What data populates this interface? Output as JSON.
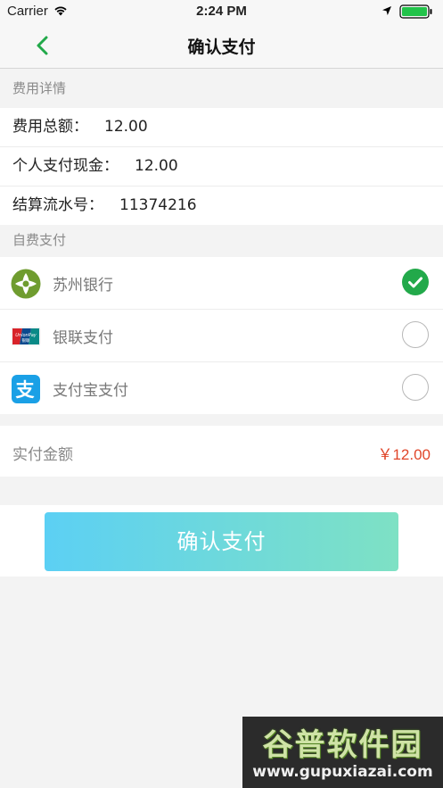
{
  "status_bar": {
    "carrier": "Carrier",
    "time": "2:24 PM"
  },
  "nav": {
    "title": "确认支付"
  },
  "fee_details": {
    "header": "费用详情",
    "rows": [
      {
        "label": "费用总额：",
        "value": "12.00"
      },
      {
        "label": "个人支付现金：",
        "value": "12.00"
      },
      {
        "label": "结算流水号：",
        "value": "11374216"
      }
    ]
  },
  "self_pay": {
    "header": "自费支付",
    "methods": [
      {
        "label": "苏州银行",
        "selected": true,
        "icon": "suzhou-bank-icon"
      },
      {
        "label": "银联支付",
        "selected": false,
        "icon": "unionpay-icon"
      },
      {
        "label": "支付宝支付",
        "selected": false,
        "icon": "alipay-icon"
      }
    ]
  },
  "amount": {
    "label": "实付金额",
    "value": "￥12.00"
  },
  "confirm_button": {
    "label": "确认支付"
  },
  "watermark": {
    "title": "谷普软件园",
    "url": "www.gupuxiazai.com"
  },
  "colors": {
    "accent_green": "#22a94a",
    "amount_red": "#e0462a",
    "button_gradient_start": "#5cd0f4",
    "button_gradient_end": "#7ee1c4"
  }
}
